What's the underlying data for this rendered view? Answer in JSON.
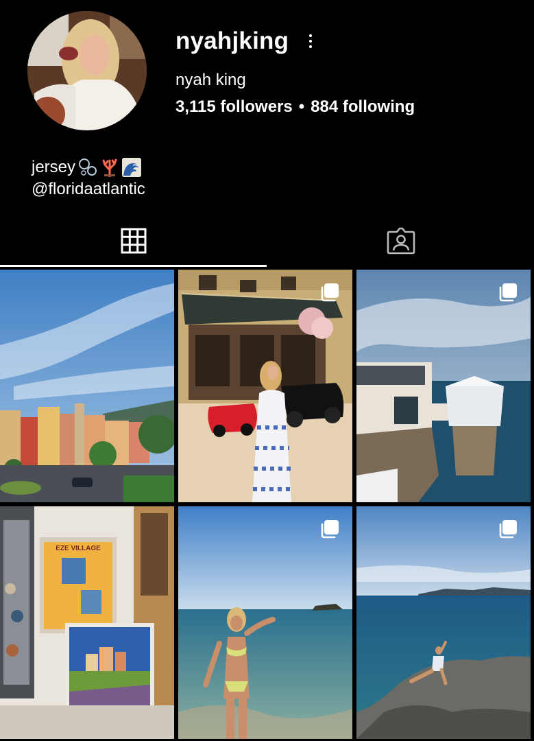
{
  "profile": {
    "username": "nyahjking",
    "display_name": "nyah king",
    "followers": "3,115 followers",
    "separator": "•",
    "following": "884 following",
    "bio_line1": "jersey",
    "bio_line2": "@floridaatlantic",
    "bio_emojis": [
      "bubbles-emoji",
      "coral-emoji",
      "wave-emoji"
    ]
  },
  "tabs": [
    {
      "name": "posts-grid",
      "icon": "grid-icon",
      "active": true
    },
    {
      "name": "tagged",
      "icon": "tagged-person-icon",
      "active": false
    }
  ],
  "posts": [
    {
      "scene": "colorful town under blue sky",
      "multiple": false
    },
    {
      "scene": "casino with red sports car",
      "multiple": true
    },
    {
      "scene": "cliffside restaurant over sea",
      "multiple": true
    },
    {
      "scene": "eze village posters",
      "multiple": false
    },
    {
      "scene": "woman in bikini in shallow sea",
      "multiple": true
    },
    {
      "scene": "person on rocks by sea",
      "multiple": true
    }
  ],
  "poster_text": "EZE VILLAGE",
  "colors": {
    "background": "#000000",
    "text": "#ffffff",
    "accent_underline": "#ffffff"
  }
}
